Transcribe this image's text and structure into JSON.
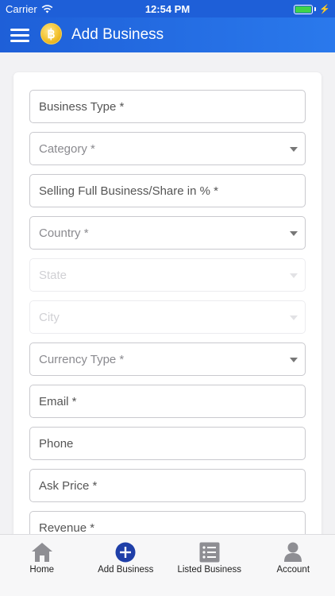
{
  "status_bar": {
    "carrier": "Carrier",
    "time": "12:54 PM"
  },
  "app_bar": {
    "title": "Add Business",
    "logo_symbol": "฿"
  },
  "form": {
    "fields": [
      {
        "label": "Business Type *",
        "type": "text"
      },
      {
        "label": "Category *",
        "type": "select"
      },
      {
        "label": "Selling Full Business/Share in % *",
        "type": "text"
      },
      {
        "label": "Country *",
        "type": "select"
      },
      {
        "label": "State",
        "type": "select",
        "disabled": true
      },
      {
        "label": "City",
        "type": "select",
        "disabled": true
      },
      {
        "label": "Currency Type *",
        "type": "select"
      },
      {
        "label": "Email *",
        "type": "text"
      },
      {
        "label": "Phone",
        "type": "text"
      },
      {
        "label": "Ask Price *",
        "type": "text"
      },
      {
        "label": "Revenue *",
        "type": "text"
      }
    ]
  },
  "tab_bar": {
    "tabs": [
      {
        "label": "Home",
        "icon": "home-icon"
      },
      {
        "label": "Add Business",
        "icon": "add-circle-icon",
        "active": true
      },
      {
        "label": "Listed Business",
        "icon": "list-icon"
      },
      {
        "label": "Account",
        "icon": "user-icon"
      }
    ]
  },
  "colors": {
    "primary": "#1e5fd8",
    "accent_dark": "#1f3fa8",
    "tab_icon": "#8e8e93"
  }
}
